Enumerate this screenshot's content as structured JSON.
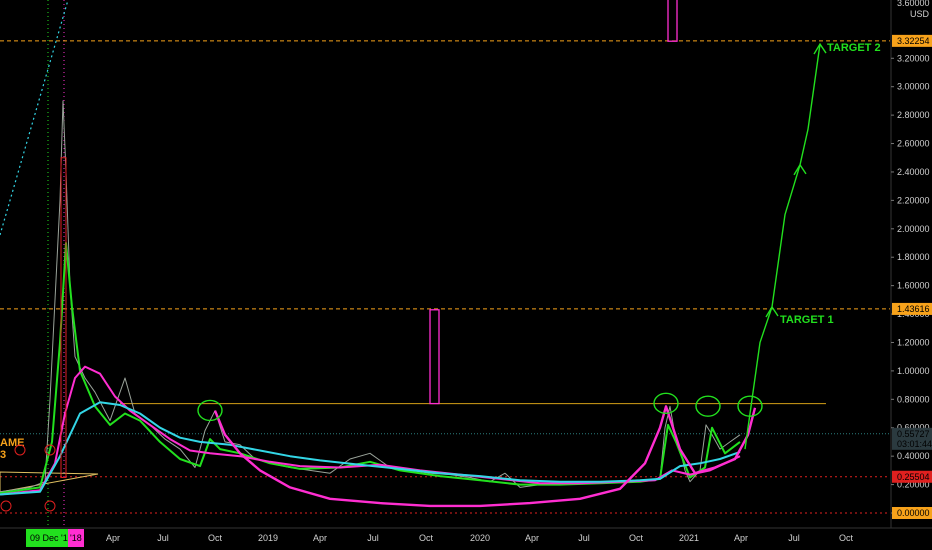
{
  "colors": {
    "background": "#000000",
    "axis_text": "#d0d0d0",
    "target_line": "#f7a21b",
    "support_line": "#e0201f",
    "resistance_line": "#d4a017",
    "green": "#22e01e",
    "magenta": "#ff2ed1",
    "cyan": "#33d6e6",
    "price_tag_bg": "#2a3036"
  },
  "chart_data": {
    "type": "line",
    "title": "",
    "x_tick_labels": [
      "Apr",
      "Jul",
      "Oct",
      "2019",
      "Apr",
      "Jul",
      "Oct",
      "2020",
      "Apr",
      "Jul",
      "Oct",
      "2021",
      "Apr",
      "Jul",
      "Oct"
    ],
    "x_highlight_label": "09 Dec '17",
    "x_highlight_suffix": "'18",
    "y_axis": {
      "min": 0,
      "max": 3.6,
      "unit": "USD",
      "tick_labels": [
        "3.20000",
        "3.00000",
        "2.80000",
        "2.60000",
        "2.40000",
        "2.20000",
        "2.00000",
        "1.80000",
        "1.60000",
        "1.40000",
        "1.20000",
        "1.00000",
        "0.80000",
        "0.60000",
        "0.40000",
        "0.20000",
        "0.00000"
      ],
      "top_partial_label": "3.60000"
    },
    "horizontal_levels": [
      {
        "name": "target_2_level",
        "value": 3.32254,
        "label": "3.32254",
        "style": "dashed",
        "color": "#f7a21b"
      },
      {
        "name": "target_1_level",
        "value": 1.43616,
        "label": "1.43616",
        "style": "dashed",
        "color": "#f7a21b"
      },
      {
        "name": "resistance",
        "value": 0.77,
        "style": "solid",
        "color": "#d4a017"
      },
      {
        "name": "support",
        "value": 0.25504,
        "label": "0.25504",
        "style": "dotted",
        "color": "#e0201f"
      },
      {
        "name": "zero",
        "value": 0.0,
        "label": "0.00000",
        "style": "dotted",
        "color": "#e0201f"
      }
    ],
    "current_price": {
      "value": 0.55727,
      "label": "0.55727",
      "countdown": "03:01:44"
    },
    "annotations": {
      "target1": "TARGET 1",
      "target2": "TARGET 2",
      "left_text": "AME",
      "left_text2": "3"
    },
    "series": [
      {
        "id": "price",
        "color": "#9aa39a",
        "points": [
          [
            0,
            0.15
          ],
          [
            30,
            0.18
          ],
          [
            45,
            0.22
          ],
          [
            50,
            0.8
          ],
          [
            55,
            1.5
          ],
          [
            60,
            2.2
          ],
          [
            63,
            2.9
          ],
          [
            66,
            2.4
          ],
          [
            70,
            1.6
          ],
          [
            75,
            1.1
          ],
          [
            85,
            0.95
          ],
          [
            95,
            0.85
          ],
          [
            110,
            0.65
          ],
          [
            125,
            0.95
          ],
          [
            135,
            0.7
          ],
          [
            150,
            0.62
          ],
          [
            165,
            0.52
          ],
          [
            180,
            0.45
          ],
          [
            195,
            0.32
          ],
          [
            205,
            0.58
          ],
          [
            215,
            0.72
          ],
          [
            225,
            0.5
          ],
          [
            240,
            0.48
          ],
          [
            255,
            0.38
          ],
          [
            270,
            0.35
          ],
          [
            290,
            0.32
          ],
          [
            310,
            0.3
          ],
          [
            330,
            0.28
          ],
          [
            350,
            0.38
          ],
          [
            370,
            0.42
          ],
          [
            390,
            0.32
          ],
          [
            410,
            0.3
          ],
          [
            430,
            0.28
          ],
          [
            450,
            0.27
          ],
          [
            470,
            0.25
          ],
          [
            490,
            0.22
          ],
          [
            505,
            0.28
          ],
          [
            520,
            0.18
          ],
          [
            540,
            0.2
          ],
          [
            560,
            0.22
          ],
          [
            580,
            0.21
          ],
          [
            600,
            0.22
          ],
          [
            620,
            0.22
          ],
          [
            640,
            0.23
          ],
          [
            660,
            0.24
          ],
          [
            665,
            0.6
          ],
          [
            670,
            0.75
          ],
          [
            675,
            0.55
          ],
          [
            680,
            0.45
          ],
          [
            685,
            0.3
          ],
          [
            690,
            0.22
          ],
          [
            700,
            0.3
          ],
          [
            706,
            0.62
          ],
          [
            712,
            0.55
          ],
          [
            720,
            0.45
          ],
          [
            730,
            0.5
          ],
          [
            740,
            0.55
          ]
        ]
      },
      {
        "id": "fast_ma",
        "color": "#22e01e",
        "points": [
          [
            0,
            0.14
          ],
          [
            40,
            0.18
          ],
          [
            52,
            0.5
          ],
          [
            60,
            1.2
          ],
          [
            66,
            1.9
          ],
          [
            72,
            1.45
          ],
          [
            80,
            1.0
          ],
          [
            95,
            0.75
          ],
          [
            110,
            0.62
          ],
          [
            125,
            0.7
          ],
          [
            140,
            0.65
          ],
          [
            160,
            0.5
          ],
          [
            180,
            0.38
          ],
          [
            200,
            0.33
          ],
          [
            210,
            0.52
          ],
          [
            220,
            0.45
          ],
          [
            240,
            0.42
          ],
          [
            270,
            0.35
          ],
          [
            300,
            0.31
          ],
          [
            340,
            0.32
          ],
          [
            370,
            0.36
          ],
          [
            400,
            0.3
          ],
          [
            440,
            0.26
          ],
          [
            480,
            0.23
          ],
          [
            520,
            0.2
          ],
          [
            560,
            0.2
          ],
          [
            600,
            0.21
          ],
          [
            640,
            0.22
          ],
          [
            660,
            0.24
          ],
          [
            668,
            0.62
          ],
          [
            676,
            0.5
          ],
          [
            690,
            0.25
          ],
          [
            705,
            0.32
          ],
          [
            712,
            0.6
          ],
          [
            725,
            0.42
          ],
          [
            740,
            0.5
          ]
        ]
      },
      {
        "id": "medium_ma",
        "color": "#ff2ed1",
        "points": [
          [
            0,
            0.13
          ],
          [
            40,
            0.16
          ],
          [
            55,
            0.35
          ],
          [
            65,
            0.7
          ],
          [
            75,
            0.95
          ],
          [
            85,
            1.03
          ],
          [
            100,
            0.98
          ],
          [
            115,
            0.82
          ],
          [
            130,
            0.72
          ],
          [
            150,
            0.62
          ],
          [
            170,
            0.52
          ],
          [
            190,
            0.44
          ],
          [
            210,
            0.42
          ],
          [
            240,
            0.4
          ],
          [
            270,
            0.36
          ],
          [
            300,
            0.33
          ],
          [
            340,
            0.32
          ],
          [
            380,
            0.34
          ],
          [
            420,
            0.3
          ],
          [
            460,
            0.27
          ],
          [
            500,
            0.24
          ],
          [
            540,
            0.21
          ],
          [
            580,
            0.21
          ],
          [
            620,
            0.22
          ],
          [
            655,
            0.23
          ],
          [
            672,
            0.3
          ],
          [
            690,
            0.27
          ],
          [
            710,
            0.3
          ],
          [
            740,
            0.4
          ]
        ]
      },
      {
        "id": "slow_ma",
        "color": "#33d6e6",
        "points": [
          [
            0,
            0.13
          ],
          [
            40,
            0.15
          ],
          [
            60,
            0.4
          ],
          [
            80,
            0.7
          ],
          [
            100,
            0.78
          ],
          [
            120,
            0.76
          ],
          [
            140,
            0.7
          ],
          [
            160,
            0.6
          ],
          [
            180,
            0.53
          ],
          [
            200,
            0.5
          ],
          [
            230,
            0.48
          ],
          [
            260,
            0.44
          ],
          [
            290,
            0.4
          ],
          [
            320,
            0.37
          ],
          [
            360,
            0.34
          ],
          [
            400,
            0.31
          ],
          [
            440,
            0.28
          ],
          [
            480,
            0.26
          ],
          [
            520,
            0.23
          ],
          [
            560,
            0.22
          ],
          [
            600,
            0.22
          ],
          [
            640,
            0.23
          ],
          [
            660,
            0.24
          ],
          [
            680,
            0.33
          ],
          [
            700,
            0.35
          ],
          [
            720,
            0.38
          ],
          [
            740,
            0.43
          ]
        ]
      },
      {
        "id": "cup_curve",
        "color": "#ff2ed1",
        "points": [
          [
            215,
            0.72
          ],
          [
            225,
            0.55
          ],
          [
            240,
            0.42
          ],
          [
            260,
            0.3
          ],
          [
            290,
            0.18
          ],
          [
            330,
            0.1
          ],
          [
            380,
            0.07
          ],
          [
            430,
            0.05
          ],
          [
            480,
            0.05
          ],
          [
            530,
            0.07
          ],
          [
            580,
            0.1
          ],
          [
            620,
            0.17
          ],
          [
            645,
            0.35
          ],
          [
            660,
            0.6
          ],
          [
            666,
            0.75
          ],
          [
            680,
            0.45
          ],
          [
            695,
            0.28
          ],
          [
            715,
            0.32
          ],
          [
            735,
            0.38
          ],
          [
            748,
            0.55
          ],
          [
            755,
            0.74
          ]
        ]
      }
    ],
    "projection": {
      "color": "#22e01e",
      "points": [
        [
          745,
          0.45
        ],
        [
          760,
          1.2
        ],
        [
          772,
          1.45
        ],
        [
          785,
          2.1
        ],
        [
          800,
          2.45
        ],
        [
          808,
          2.7
        ],
        [
          820,
          3.3
        ]
      ]
    },
    "circles": [
      {
        "x": 210,
        "y": 0.75
      },
      {
        "x": 666,
        "y": 0.8
      },
      {
        "x": 708,
        "y": 0.78
      },
      {
        "x": 750,
        "y": 0.78
      }
    ],
    "rectangles": [
      {
        "x": 430,
        "y_top": 1.43,
        "y_bottom": 0.77,
        "color": "#ff2ed1"
      },
      {
        "x": 668,
        "y_top": 3.65,
        "y_bottom": 3.32,
        "color": "#ff2ed1"
      }
    ]
  }
}
